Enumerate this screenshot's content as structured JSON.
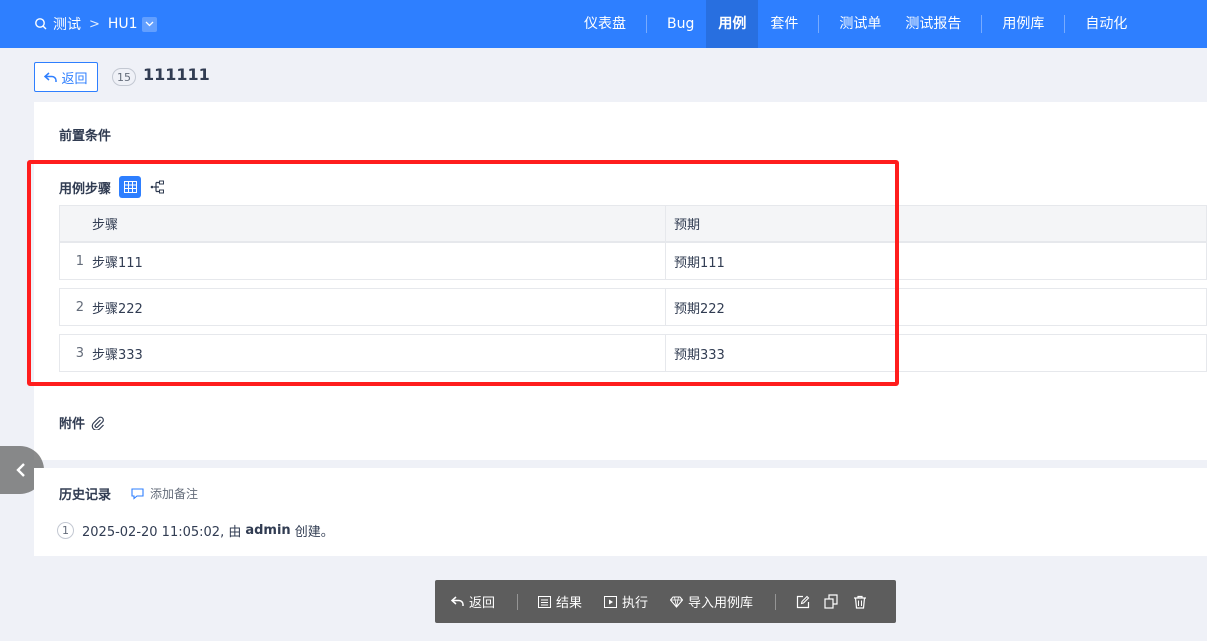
{
  "topbar": {
    "breadcrumb": {
      "product": "测试",
      "separator": ">",
      "module": "HU1"
    },
    "nav": [
      "仪表盘",
      "Bug",
      "用例",
      "套件",
      "测试单",
      "测试报告",
      "用例库",
      "自动化"
    ],
    "active_nav": "用例",
    "accent": "#2e7fff"
  },
  "header": {
    "back_label": "返回",
    "case_id": "15",
    "case_title": "111111"
  },
  "main": {
    "precondition_label": "前置条件",
    "steps_label": "用例步骤",
    "table": {
      "col_step": "步骤",
      "col_expect": "预期",
      "rows": [
        {
          "num": "1",
          "step": "步骤111",
          "expect": "预期111"
        },
        {
          "num": "2",
          "step": "步骤222",
          "expect": "预期222"
        },
        {
          "num": "3",
          "step": "步骤333",
          "expect": "预期333"
        }
      ]
    },
    "attachments_label": "附件"
  },
  "history": {
    "title": "历史记录",
    "add_note": "添加备注",
    "entries": [
      {
        "num": "1",
        "prefix": "2025-02-20 11:05:02, 由",
        "user": "admin",
        "suffix": "创建。"
      }
    ]
  },
  "toolbar": {
    "back": "返回",
    "result": "结果",
    "run": "执行",
    "import": "导入用例库"
  },
  "highlight_color": "#ff1d1d"
}
